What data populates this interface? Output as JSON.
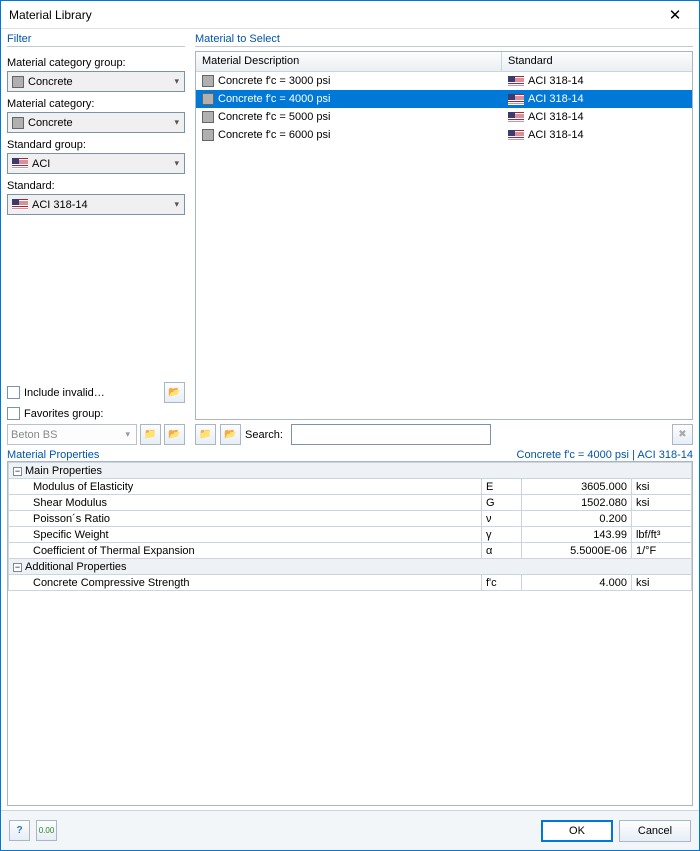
{
  "title": "Material Library",
  "filter": {
    "section": "Filter",
    "catgroup_label": "Material category group:",
    "catgroup_value": "Concrete",
    "cat_label": "Material category:",
    "cat_value": "Concrete",
    "stdgroup_label": "Standard group:",
    "stdgroup_value": "ACI",
    "std_label": "Standard:",
    "std_value": "ACI 318-14",
    "include_invalid": "Include invalid…",
    "favorites_label": "Favorites group:",
    "favorites_value": "Beton BS"
  },
  "select": {
    "section": "Material to Select",
    "col1": "Material Description",
    "col2": "Standard",
    "rows": [
      {
        "desc": "Concrete f'c = 3000 psi",
        "std": "ACI 318-14"
      },
      {
        "desc": "Concrete f'c = 4000 psi",
        "std": "ACI 318-14"
      },
      {
        "desc": "Concrete f'c = 5000 psi",
        "std": "ACI 318-14"
      },
      {
        "desc": "Concrete f'c = 6000 psi",
        "std": "ACI 318-14"
      }
    ],
    "search_label": "Search:"
  },
  "props": {
    "section": "Material Properties",
    "context": "Concrete f'c = 4000 psi  |  ACI 318-14",
    "main_section": "Main Properties",
    "add_section": "Additional Properties",
    "rows": [
      {
        "name": "Modulus of Elasticity",
        "sym": "E",
        "val": "3605.000",
        "unit": "ksi"
      },
      {
        "name": "Shear Modulus",
        "sym": "G",
        "val": "1502.080",
        "unit": "ksi"
      },
      {
        "name": "Poisson´s Ratio",
        "sym": "ν",
        "val": "0.200",
        "unit": ""
      },
      {
        "name": "Specific Weight",
        "sym": "γ",
        "val": "143.99",
        "unit": "lbf/ft³"
      },
      {
        "name": "Coefficient of Thermal Expansion",
        "sym": "α",
        "val": "5.5000E-06",
        "unit": "1/°F"
      }
    ],
    "addrows": [
      {
        "name": "Concrete Compressive Strength",
        "sym": "f'c",
        "val": "4.000",
        "unit": "ksi"
      }
    ]
  },
  "buttons": {
    "ok": "OK",
    "cancel": "Cancel"
  }
}
